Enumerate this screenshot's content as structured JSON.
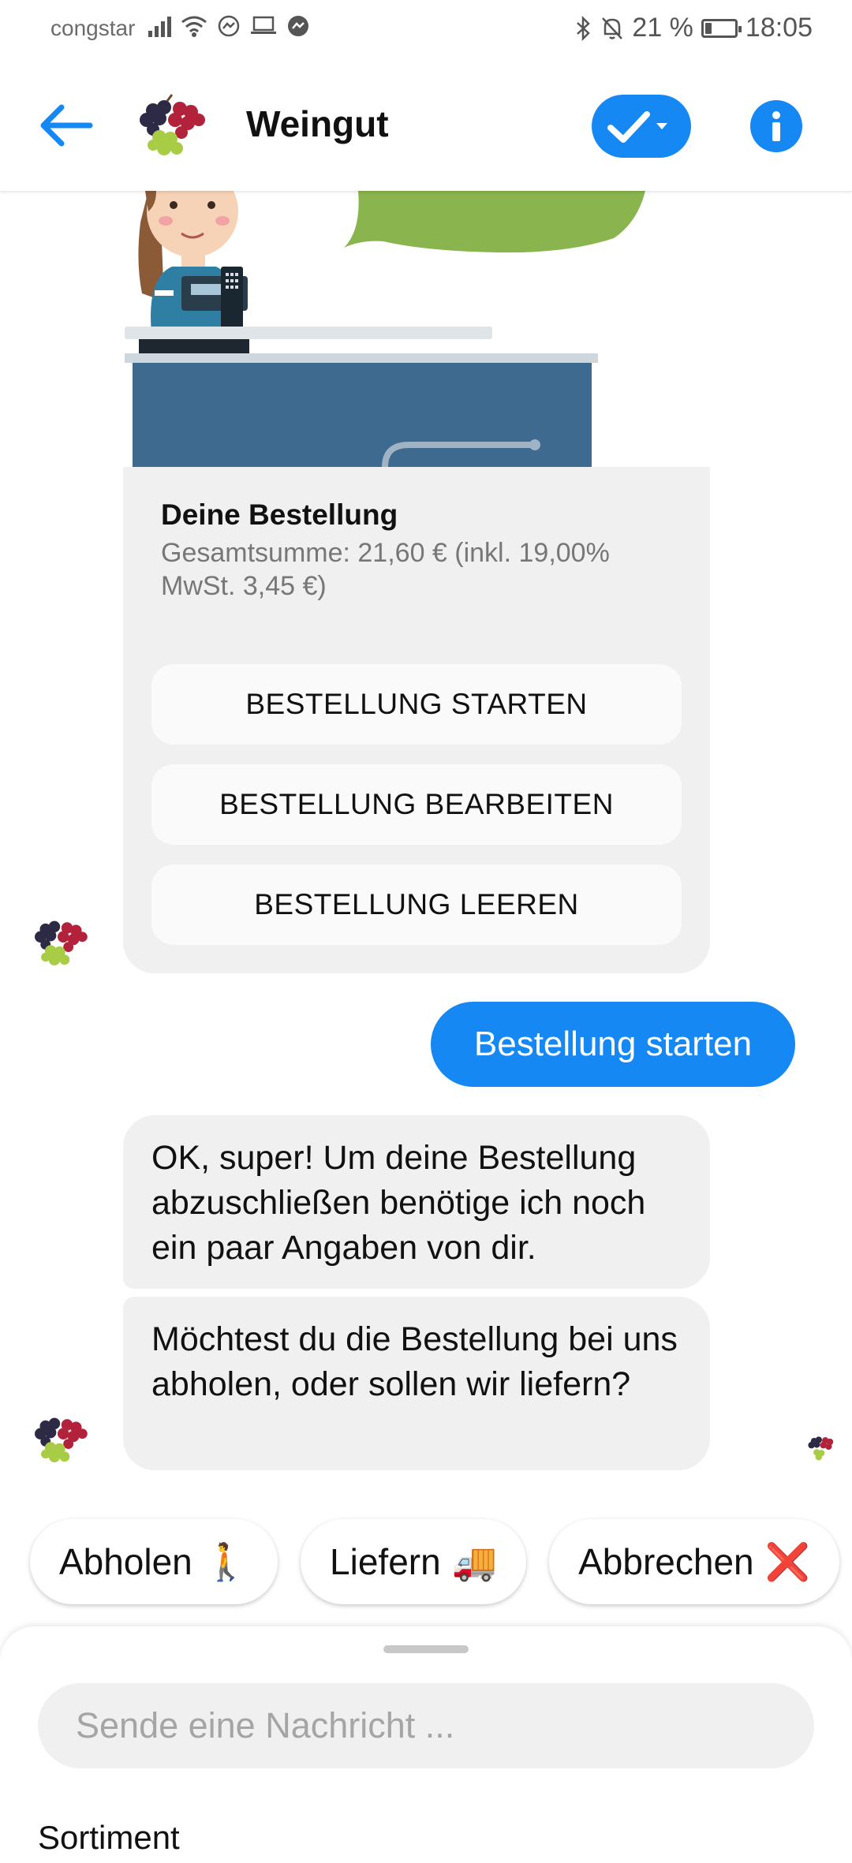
{
  "status_bar": {
    "carrier": "congstar",
    "battery": "21 %",
    "battery_level": 0.21,
    "time": "18:05",
    "icons": [
      "signal-icon",
      "wifi-icon",
      "messenger-icon",
      "laptop-icon",
      "messenger-icon",
      "bluetooth-icon",
      "bell-off-icon",
      "battery-icon"
    ]
  },
  "header": {
    "title": "Weingut",
    "back_icon": "arrow-left-icon",
    "status_icon": "checkmark-dropdown-icon",
    "info_icon": "info-icon"
  },
  "colors": {
    "accent": "#1688f4",
    "bubble_gray": "#f0f0f0",
    "text_gray": "#777777"
  },
  "order_card": {
    "title": "Deine Bestellung",
    "subtitle": "Gesamtsumme: 21,60 € (inkl. 19,00% MwSt. 3,45 €)",
    "buttons": [
      "BESTELLUNG STARTEN",
      "BESTELLUNG BEARBEITEN",
      "BESTELLUNG LEEREN"
    ]
  },
  "messages": {
    "user": "Bestellung starten",
    "bot_1": "OK, super! Um deine Bestellung abzuschließen benötige ich noch ein paar Angaben von dir.",
    "bot_2": "Möchtest du die Bestellung bei uns abholen, oder sollen wir liefern?"
  },
  "quick_replies": [
    {
      "label": "Abholen",
      "emoji": "🚶"
    },
    {
      "label": "Liefern",
      "emoji": "🚚"
    },
    {
      "label": "Abbrechen",
      "emoji": "❌"
    }
  ],
  "composer": {
    "placeholder": "Sende eine Nachricht ...",
    "menu_item": "Sortiment"
  }
}
